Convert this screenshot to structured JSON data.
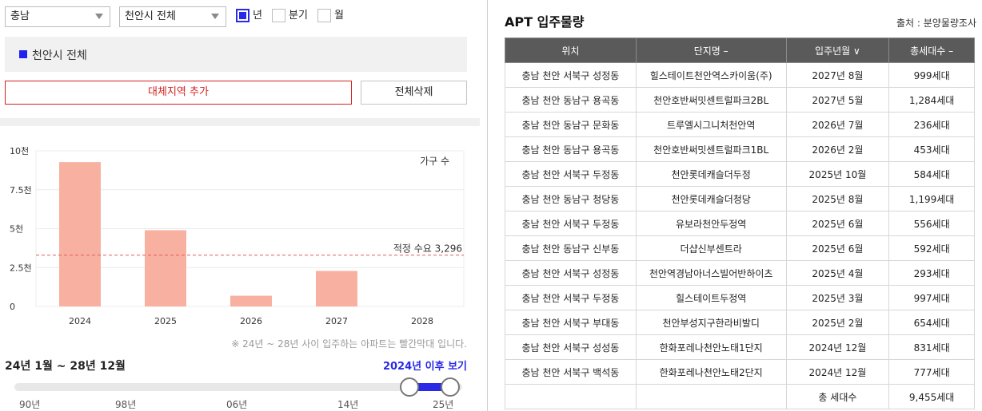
{
  "filters": {
    "province": "충남",
    "city": "천안시 전체",
    "period_options": [
      {
        "label": "년",
        "checked": true
      },
      {
        "label": "분기",
        "checked": false
      },
      {
        "label": "월",
        "checked": false
      }
    ]
  },
  "region_chip": "천안시 전체",
  "buttons": {
    "add_region": "대체지역 추가",
    "delete_all": "전체삭제"
  },
  "chart_data": {
    "type": "bar",
    "categories": [
      "2024",
      "2025",
      "2026",
      "2027",
      "2028"
    ],
    "values": [
      9276,
      4899,
      689,
      2283,
      0
    ],
    "yticks": [
      "10천",
      "7.5천",
      "5천",
      "2.5천",
      "0"
    ],
    "ylim": [
      0,
      10000
    ],
    "legend": "가구 수",
    "reference_line": {
      "label": "적정 수요 3,296",
      "value": 3296
    },
    "bar_color": "#f8b1a1",
    "reference_color": "#e05a5a"
  },
  "note": "※ 24년 ~ 28년 사이 입주하는 아파트는 빨간막대 입니다.",
  "range": {
    "label": "24년 1월 ~ 28년 12월",
    "link": "2024년 이후 보기",
    "ticks": [
      "90년",
      "98년",
      "06년",
      "14년",
      "25년"
    ],
    "accent": "#2a2ae6"
  },
  "table": {
    "title": "APT 입주물량",
    "source": "출처 : 분양물량조사",
    "headers": [
      "위치",
      "단지명 –",
      "입주년월 ∨",
      "총세대수 –"
    ],
    "rows": [
      [
        "충남 천안 서북구 성정동",
        "힐스테이트천안역스카이움(주)",
        "2027년 8월",
        "999세대"
      ],
      [
        "충남 천안 동남구 용곡동",
        "천안호반써밋센트럴파크2BL",
        "2027년 5월",
        "1,284세대"
      ],
      [
        "충남 천안 동남구 문화동",
        "트루엘시그니처천안역",
        "2026년 7월",
        "236세대"
      ],
      [
        "충남 천안 동남구 용곡동",
        "천안호반써밋센트럴파크1BL",
        "2026년 2월",
        "453세대"
      ],
      [
        "충남 천안 서북구 두정동",
        "천안롯데캐슬더두정",
        "2025년 10월",
        "584세대"
      ],
      [
        "충남 천안 동남구 청당동",
        "천안롯데캐슬더청당",
        "2025년 8월",
        "1,199세대"
      ],
      [
        "충남 천안 서북구 두정동",
        "유보라천안두정역",
        "2025년 6월",
        "556세대"
      ],
      [
        "충남 천안 동남구 신부동",
        "더샵신부센트라",
        "2025년 6월",
        "592세대"
      ],
      [
        "충남 천안 서북구 성정동",
        "천안역경남아너스빌어반하이츠",
        "2025년 4월",
        "293세대"
      ],
      [
        "충남 천안 서북구 두정동",
        "힐스테이트두정역",
        "2025년 3월",
        "997세대"
      ],
      [
        "충남 천안 서북구 부대동",
        "천안부성지구한라비발디",
        "2025년 2월",
        "654세대"
      ],
      [
        "충남 천안 서북구 성성동",
        "한화포레나천안노태1단지",
        "2024년 12월",
        "831세대"
      ],
      [
        "충남 천안 서북구 백석동",
        "한화포레나천안노태2단지",
        "2024년 12월",
        "777세대"
      ]
    ],
    "total_label": "총 세대수",
    "total_value": "9,455세대"
  }
}
